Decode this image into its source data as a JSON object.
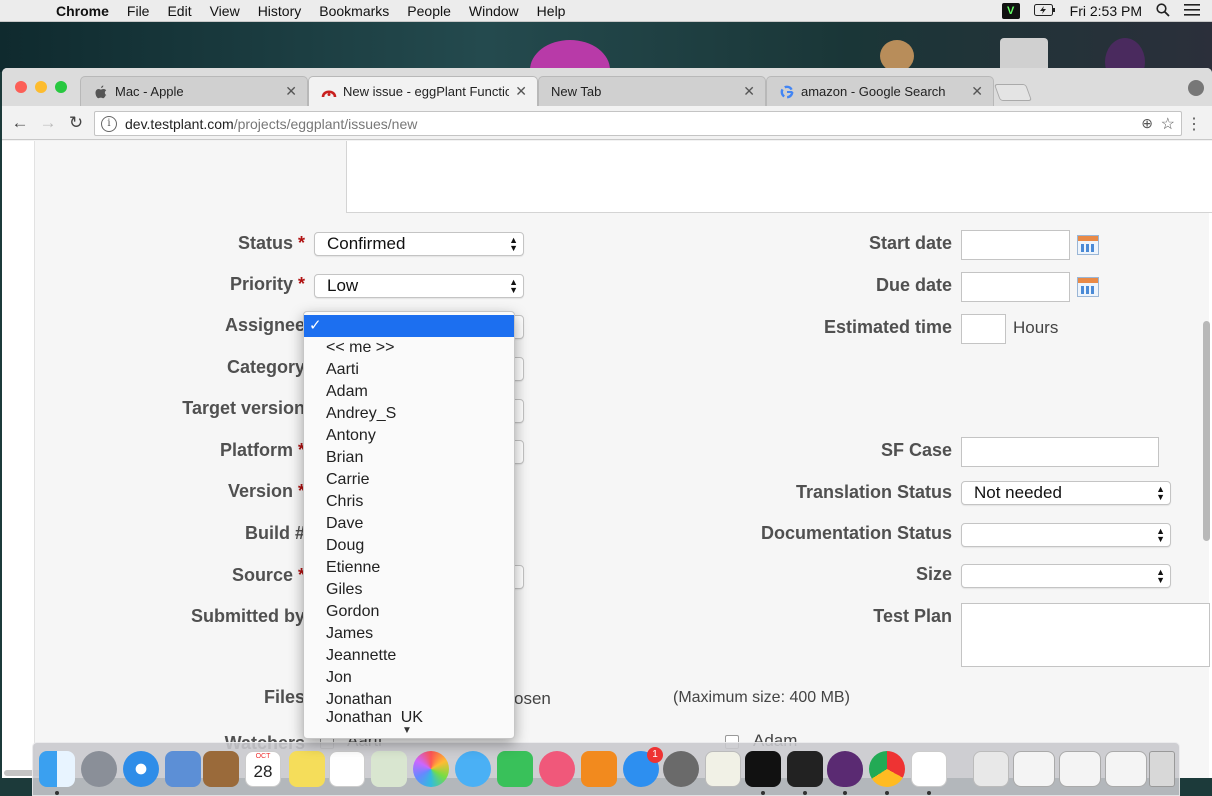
{
  "menubar": {
    "apple_icon": "apple-logo",
    "items": [
      "Chrome",
      "File",
      "Edit",
      "View",
      "History",
      "Bookmarks",
      "People",
      "Window",
      "Help"
    ],
    "clock": "Fri 2:53 PM"
  },
  "tabs": [
    {
      "title": "Mac - Apple",
      "icon": "apple-favicon"
    },
    {
      "title": "New issue - eggPlant Function",
      "icon": "testplant-favicon"
    },
    {
      "title": "New Tab",
      "icon": ""
    },
    {
      "title": "amazon - Google Search",
      "icon": "google-favicon"
    }
  ],
  "address": {
    "host": "dev.testplant.com",
    "path": "/projects/eggplant/issues/new"
  },
  "form": {
    "left_labels": {
      "status": "Status",
      "priority": "Priority",
      "assignee": "Assignee",
      "category": "Category",
      "target_version": "Target version",
      "platform": "Platform",
      "version": "Version",
      "build": "Build #",
      "source": "Source",
      "submitted_by": "Submitted by",
      "files": "Files",
      "watchers": "Watchers"
    },
    "required_mark": "*",
    "status_value": "Confirmed",
    "priority_value": "Low",
    "right_labels": {
      "start_date": "Start date",
      "due_date": "Due date",
      "estimated_time": "Estimated time",
      "sf_case": "SF Case",
      "translation_status": "Translation Status",
      "documentation_status": "Documentation Status",
      "size": "Size",
      "test_plan": "Test Plan"
    },
    "hours_label": "Hours",
    "translation_status_value": "Not needed",
    "files_note": "(Maximum size: 400 MB)",
    "files_chosen_fragment": "osen",
    "watchers": [
      "Aarti",
      "Adam"
    ]
  },
  "assignee_dropdown": {
    "selected": "✓",
    "options": [
      "<< me >>",
      "Aarti",
      "Adam",
      "Andrey_S",
      "Antony",
      "Brian",
      "Carrie",
      "Chris",
      "Dave",
      "Doug",
      "Etienne",
      "Giles",
      "Gordon",
      "James",
      "Jeannette",
      "Jon",
      "Jonathan",
      "Jonathan_UK"
    ]
  },
  "dock": {
    "calendar_day": "28",
    "calendar_month": "OCT",
    "appstore_badge": "1"
  }
}
